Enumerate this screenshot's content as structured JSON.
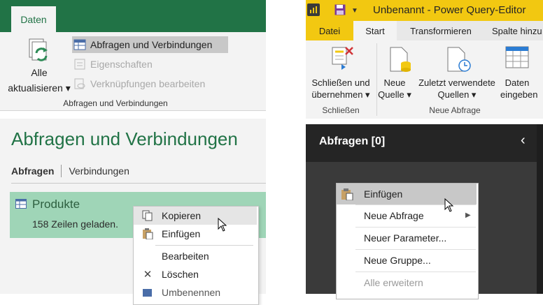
{
  "excel": {
    "ribbon_tab": "Daten",
    "refresh_label_line1": "Alle",
    "refresh_label_line2": "aktualisieren ▾",
    "items": [
      {
        "label": "Abfragen und Verbindungen",
        "icon": "table-icon"
      },
      {
        "label": "Eigenschaften",
        "icon": "properties-icon"
      },
      {
        "label": "Verknüpfungen bearbeiten",
        "icon": "links-icon"
      }
    ],
    "group_label": "Abfragen und Verbindungen",
    "pane_title": "Abfragen und Verbindungen",
    "tabs": {
      "queries": "Abfragen",
      "connections": "Verbindungen"
    },
    "query": {
      "name": "Produkte",
      "info": "158 Zeilen geladen."
    },
    "context_menu": [
      {
        "label": "Kopieren",
        "icon": "copy-icon"
      },
      {
        "label": "Einfügen",
        "icon": "paste-icon"
      },
      {
        "label": "Bearbeiten",
        "icon": ""
      },
      {
        "label": "Löschen",
        "icon": "delete-icon"
      },
      {
        "label": "Umbenennen",
        "icon": "rename-icon"
      }
    ],
    "colors": {
      "brand": "#217346",
      "query_highlight": "#9fd5b7"
    }
  },
  "powerbi": {
    "window_title": "Unbenannt - Power Query-Editor",
    "tabs": [
      "Datei",
      "Start",
      "Transformieren",
      "Spalte hinzu"
    ],
    "buttons": [
      {
        "line1": "Schließen und",
        "line2": "übernehmen ▾",
        "icon": "close-apply-icon"
      },
      {
        "line1": "Neue",
        "line2": "Quelle ▾",
        "icon": "new-source-icon"
      },
      {
        "line1": "Zuletzt verwendete",
        "line2": "Quellen ▾",
        "icon": "recent-sources-icon"
      },
      {
        "line1": "Daten",
        "line2": "eingeben",
        "icon": "enter-data-icon"
      }
    ],
    "groups": {
      "close": "Schließen",
      "new_query": "Neue Abfrage"
    },
    "pane_title": "Abfragen [0]",
    "context_menu": [
      "Einfügen",
      "Neue Abfrage",
      "Neuer Parameter...",
      "Neue Gruppe...",
      "Alle erweitern"
    ],
    "colors": {
      "brand": "#f2c811",
      "pane": "#3a3a3a"
    }
  }
}
